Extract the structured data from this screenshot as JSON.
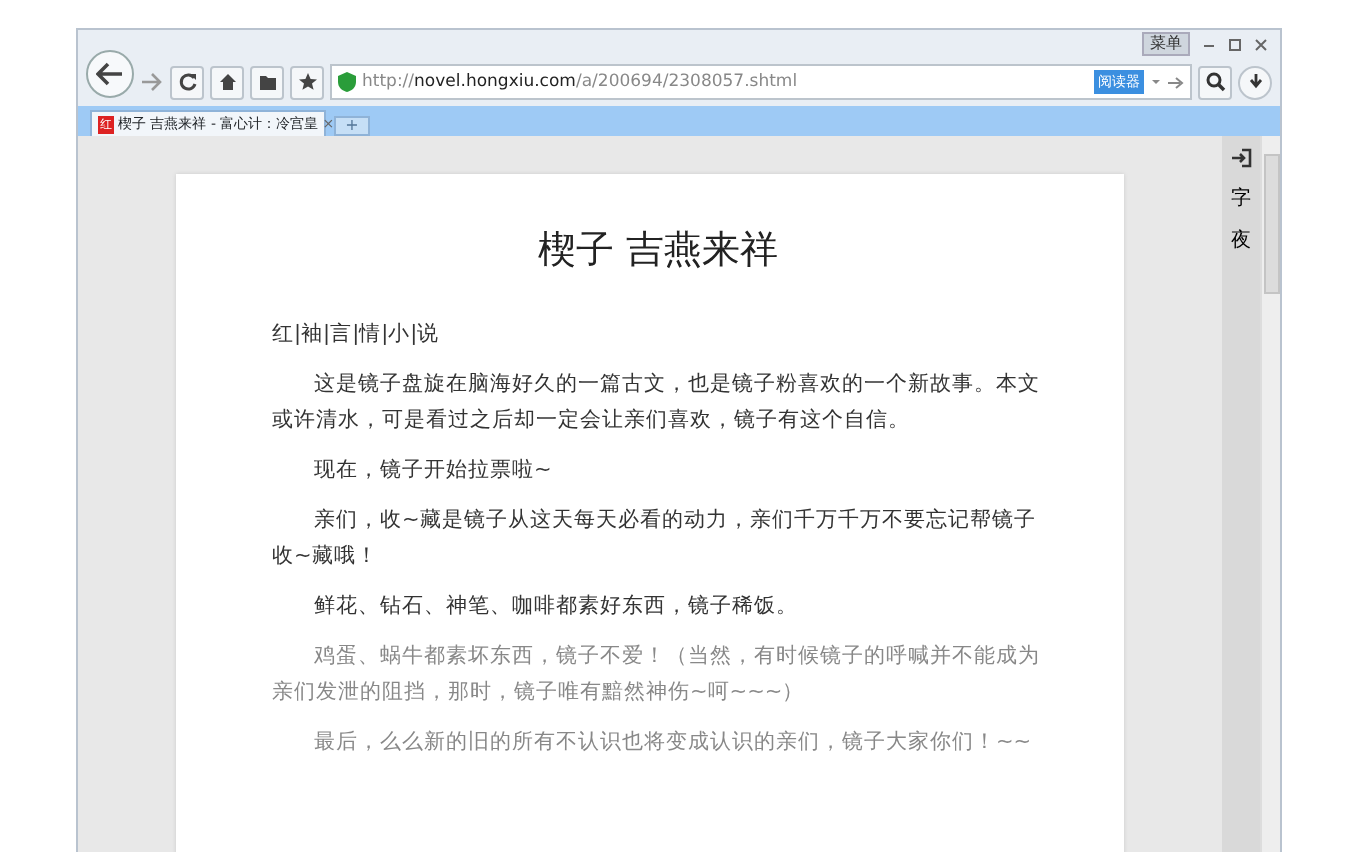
{
  "window": {
    "menu_button": "菜单"
  },
  "toolbar": {
    "url_scheme": "http://",
    "url_host": "novel.hongxiu.com",
    "url_path": "/a/200694/2308057.shtml",
    "reader_badge": "阅读器"
  },
  "tabs": [
    {
      "favicon": "红",
      "title": "楔子 吉燕来祥 - 富心计：冷宫皇",
      "selected": true,
      "close": "×"
    }
  ],
  "new_tab": "+",
  "side_tools": [
    {
      "kind": "icon"
    },
    {
      "kind": "text",
      "label": "字"
    },
    {
      "kind": "text",
      "label": "夜"
    }
  ],
  "article": {
    "title": "楔子 吉燕来祥",
    "category": "红|袖|言|情|小|说",
    "paragraphs": [
      "这是镜子盘旋在脑海好久的一篇古文，也是镜子粉喜欢的一个新故事。本文或许清水，可是看过之后却一定会让亲们喜欢，镜子有这个自信。",
      "现在，镜子开始拉票啦~",
      "亲们，收~藏是镜子从这天每天必看的动力，亲们千万千万不要忘记帮镜子收~藏哦！",
      "鲜花、钻石、神笔、咖啡都素好东西，镜子稀饭。",
      "鸡蛋、蜗牛都素坏东西，镜子不爱！（当然，有时候镜子的呼喊并不能成为亲们发泄的阻挡，那时，镜子唯有黯然神伤~呵~~~）",
      "最后，么么新的旧的所有不认识也将变成认识的亲们，镜子大家你们！~~"
    ]
  }
}
